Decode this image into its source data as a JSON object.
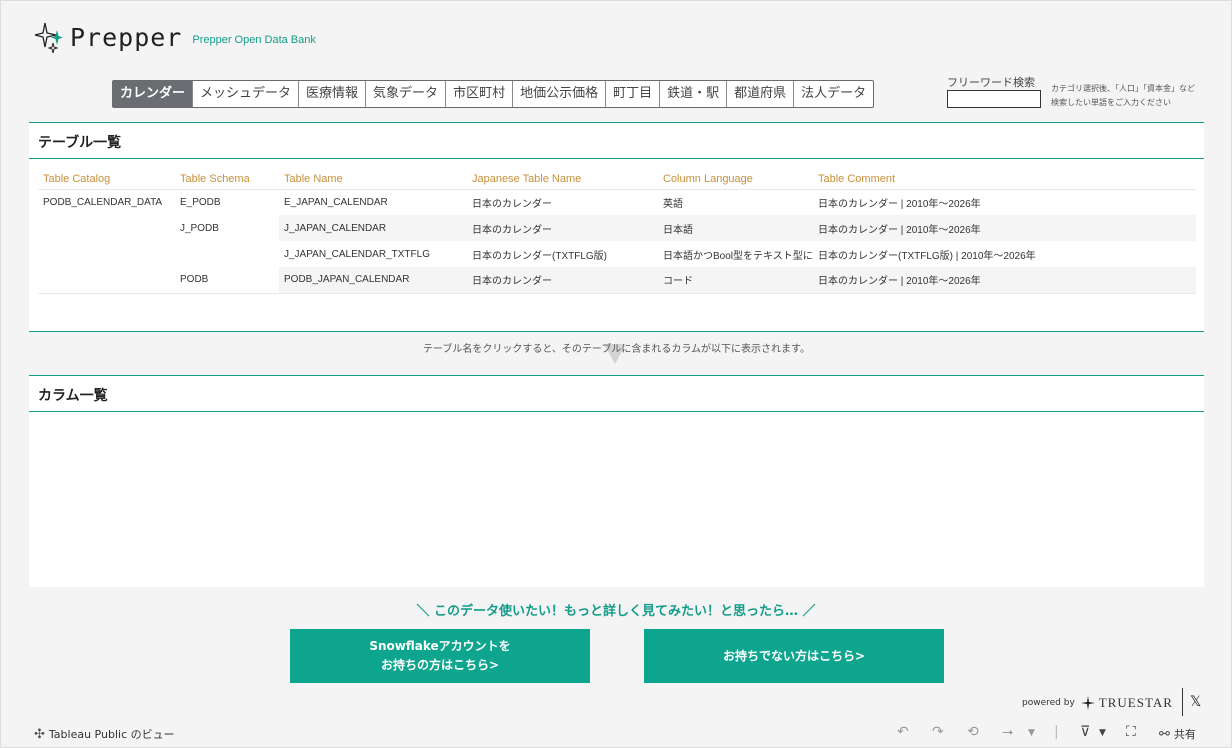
{
  "header": {
    "logo_text": "Prepper",
    "logo_sub": "Prepper Open Data Bank"
  },
  "tabs": [
    {
      "label": "カレンダー",
      "active": true
    },
    {
      "label": "メッシュデータ"
    },
    {
      "label": "医療情報"
    },
    {
      "label": "気象データ"
    },
    {
      "label": "市区町村"
    },
    {
      "label": "地価公示価格"
    },
    {
      "label": "町丁目"
    },
    {
      "label": "鉄道・駅"
    },
    {
      "label": "都道府県"
    },
    {
      "label": "法人データ"
    }
  ],
  "search": {
    "label": "フリーワード検索",
    "value": "",
    "note_line1": "カテゴリ選択後、「人口」「資本金」など",
    "note_line2": "検索したい単語をご入力ください"
  },
  "table_panel": {
    "title": "テーブル一覧",
    "columns": [
      "Table Catalog",
      "Table Schema",
      "Table Name",
      "Japanese Table Name",
      "Column Language",
      "Table Comment"
    ],
    "rows": [
      [
        "PODB_CALENDAR_DATA",
        "E_PODB",
        "E_JAPAN_CALENDAR",
        "日本のカレンダー",
        "英語",
        "日本のカレンダー | 2010年～2026年"
      ],
      [
        "",
        "J_PODB",
        "J_JAPAN_CALENDAR",
        "日本のカレンダー",
        "日本語",
        "日本のカレンダー | 2010年～2026年"
      ],
      [
        "",
        "",
        "J_JAPAN_CALENDAR_TXTFLG",
        "日本のカレンダー(TXTFLG版)",
        "日本語かつBool型をテキスト型に置..",
        "日本のカレンダー(TXTFLG版) | 2010年～2026年"
      ],
      [
        "",
        "PODB",
        "PODB_JAPAN_CALENDAR",
        "日本のカレンダー",
        "コード",
        "日本のカレンダー | 2010年～2026年"
      ]
    ]
  },
  "hint": "テーブル名をクリックすると、そのテーブルに含まれるカラムが以下に表示されます。",
  "column_panel": {
    "title": "カラム一覧"
  },
  "cta": {
    "text": "＼ このデータ使いたい！もっと詳しく見てみたい！と思ったら… ／",
    "btn1_line1": "Snowflakeアカウントを",
    "btn1_line2": "お持ちの方はこちら>",
    "btn2": "お持ちでない方はこちら>"
  },
  "powered": {
    "prefix": "powered by",
    "brand": "TRUESTAR",
    "x": "𝕏"
  },
  "footer": {
    "tableau": "Tableau Public のビュー",
    "share": "共有"
  },
  "colors": {
    "accent": "#139c89",
    "button": "#0ea58e",
    "header_gold": "#c8913a",
    "active_tab": "#6a6e73"
  }
}
